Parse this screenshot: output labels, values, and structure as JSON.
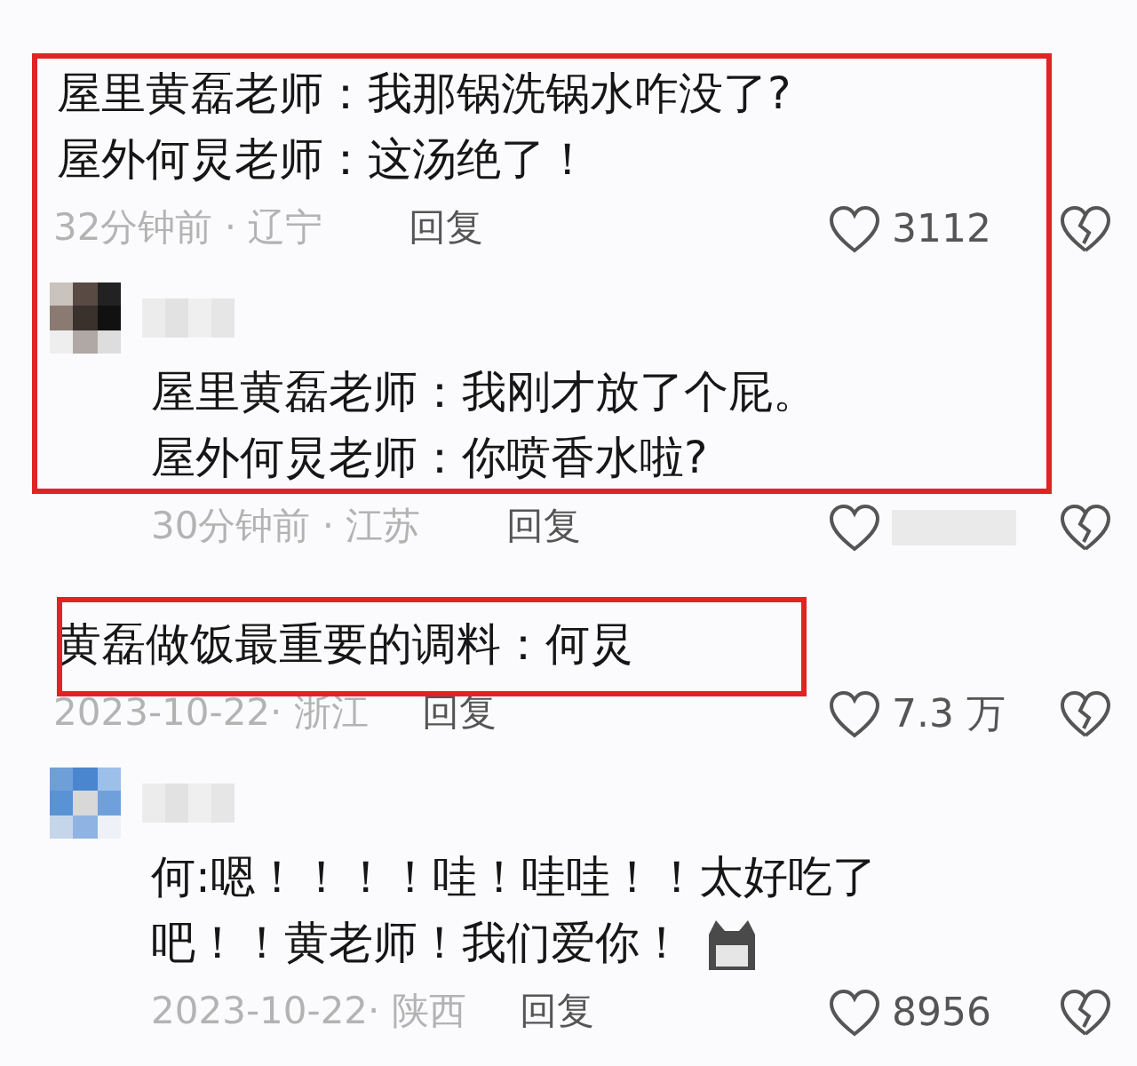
{
  "comments": [
    {
      "frame": {
        "kind": "block"
      },
      "lines": [
        "屋里黄磊老师：我那锅洗锅水咋没了?",
        "屋外何炅老师：这汤绝了！"
      ],
      "meta": "32分钟前 · 辽宁",
      "reply": "回复",
      "likes": "3112",
      "replies": [
        {
          "avatar": {
            "kind": "dark"
          },
          "lines": [
            "屋里黄磊老师：我刚才放了个屁。",
            "屋外何炅老师：你喷香水啦?"
          ],
          "meta": "30分钟前 · 江苏",
          "reply": "回复"
        }
      ]
    },
    {
      "frame": {
        "kind": "text"
      },
      "lines": [
        "黄磊做饭最重要的调料：何炅"
      ],
      "meta": "2023-10-22· 浙江",
      "reply": "回复",
      "likes": "7.3 万",
      "replies": [
        {
          "avatar": {
            "kind": "blue"
          },
          "lines": [
            "何:嗯！！！！哇！哇哇！！太好吃了",
            "吧！！黄老师！我们爱你！"
          ],
          "sticker": true,
          "meta": "2023-10-22· 陕西",
          "reply": "回复",
          "likes": "8956"
        }
      ]
    }
  ]
}
